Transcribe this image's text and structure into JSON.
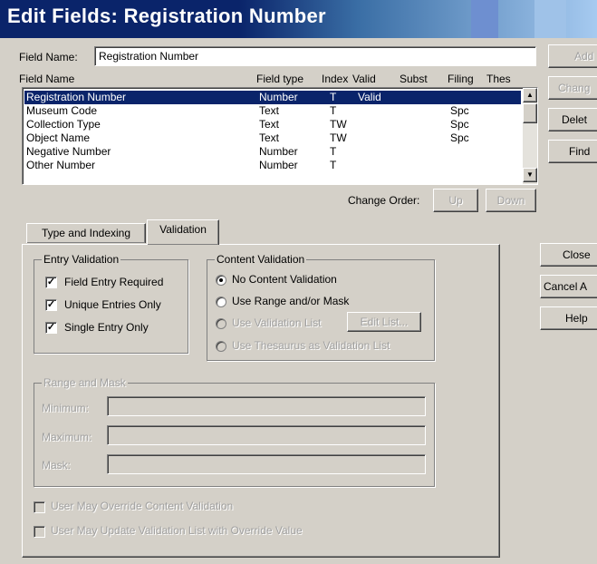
{
  "window": {
    "title": "Edit Fields: Registration Number"
  },
  "field_name": {
    "label": "Field Name:",
    "value": "Registration Number"
  },
  "list": {
    "headers": [
      "Field Name",
      "Field type",
      "Index",
      "Valid",
      "Subst",
      "Filing",
      "Thes"
    ],
    "rows": [
      {
        "name": "Registration Number",
        "type": "Number",
        "index": "T",
        "valid": "Valid",
        "subst": "",
        "filing": "",
        "thes": "",
        "selected": true
      },
      {
        "name": "Museum Code",
        "type": "Text",
        "index": "T",
        "valid": "",
        "subst": "",
        "filing": "Spc",
        "thes": ""
      },
      {
        "name": "Collection Type",
        "type": "Text",
        "index": "TW",
        "valid": "",
        "subst": "",
        "filing": "Spc",
        "thes": ""
      },
      {
        "name": "Object Name",
        "type": "Text",
        "index": "TW",
        "valid": "",
        "subst": "",
        "filing": "Spc",
        "thes": ""
      },
      {
        "name": "Negative Number",
        "type": "Number",
        "index": "T",
        "valid": "",
        "subst": "",
        "filing": "",
        "thes": ""
      },
      {
        "name": "Other Number",
        "type": "Number",
        "index": "T",
        "valid": "",
        "subst": "",
        "filing": "",
        "thes": ""
      }
    ]
  },
  "change_order": {
    "label": "Change Order:",
    "up": "Up",
    "down": "Down"
  },
  "side_buttons": {
    "add": "Add",
    "change": "Chang",
    "delete": "Delet",
    "find": "Find",
    "close": "Close",
    "cancel": "Cancel A",
    "help": "Help"
  },
  "tabs": {
    "type_indexing": "Type and Indexing",
    "validation": "Validation",
    "active": "Validation"
  },
  "entry_validation": {
    "title": "Entry Validation",
    "items": [
      {
        "label": "Field Entry Required",
        "checked": true
      },
      {
        "label": "Unique Entries Only",
        "checked": true
      },
      {
        "label": "Single Entry Only",
        "checked": true
      }
    ]
  },
  "content_validation": {
    "title": "Content Validation",
    "options": [
      {
        "label": "No Content Validation",
        "selected": true,
        "enabled": true
      },
      {
        "label": "Use Range and/or Mask",
        "selected": false,
        "enabled": true
      },
      {
        "label": "Use Validation List",
        "selected": false,
        "enabled": false
      },
      {
        "label": "Use Thesaurus as Validation List",
        "selected": false,
        "enabled": false
      }
    ],
    "edit_list_button": "Edit List..."
  },
  "range_mask": {
    "title": "Range and Mask",
    "minimum_label": "Minimum:",
    "minimum_value": "",
    "maximum_label": "Maximum:",
    "maximum_value": "",
    "mask_label": "Mask:",
    "mask_value": ""
  },
  "override": {
    "content_validation": {
      "label": "User May Override Content Validation",
      "checked": false
    },
    "update_list": {
      "label": "User May Update Validation List with Override Value",
      "checked": false
    }
  },
  "colors": {
    "title_bar": "#0a246a",
    "selection": "#0a246a",
    "face": "#d4d0c8"
  }
}
